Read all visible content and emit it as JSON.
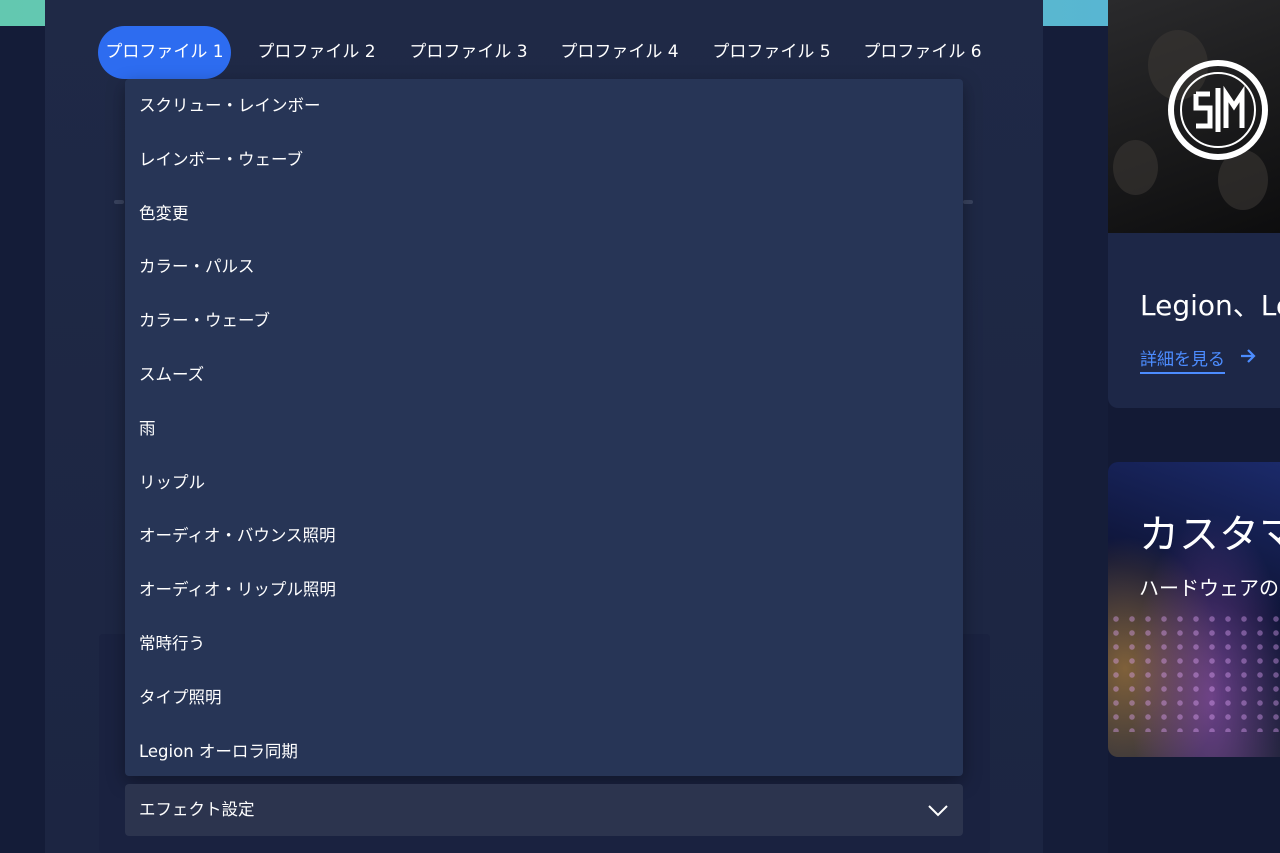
{
  "profile_tabs": [
    {
      "label": "プロファイル 1",
      "active": true
    },
    {
      "label": "プロファイル 2",
      "active": false
    },
    {
      "label": "プロファイル 3",
      "active": false
    },
    {
      "label": "プロファイル 4",
      "active": false
    },
    {
      "label": "プロファイル 5",
      "active": false
    },
    {
      "label": "プロファイル 6",
      "active": false
    }
  ],
  "effect_menu": {
    "items": [
      "スクリュー・レインボー",
      "レインボー・ウェーブ",
      "色変更",
      "カラー・パルス",
      "カラー・ウェーブ",
      "スムーズ",
      "雨",
      "リップル",
      "オーディオ・バウンス照明",
      "オーディオ・リップル照明",
      "常時行う",
      "タイプ照明",
      "Legion オーロラ同期"
    ]
  },
  "effect_settings": {
    "label": "エフェクト設定",
    "icon": "chevron-down-icon"
  },
  "side_cards": {
    "card1": {
      "title": "Legion、Le",
      "link": "詳細を見る",
      "logo": "tsm-logo"
    },
    "card2": {
      "title": "カスタマイ",
      "subtitle": "ハードウェアの照"
    }
  },
  "colors": {
    "accent": "#2d6cf0",
    "link": "#4c8cff",
    "menu_bg": "#273556",
    "panel_bg": "#1f2946"
  }
}
